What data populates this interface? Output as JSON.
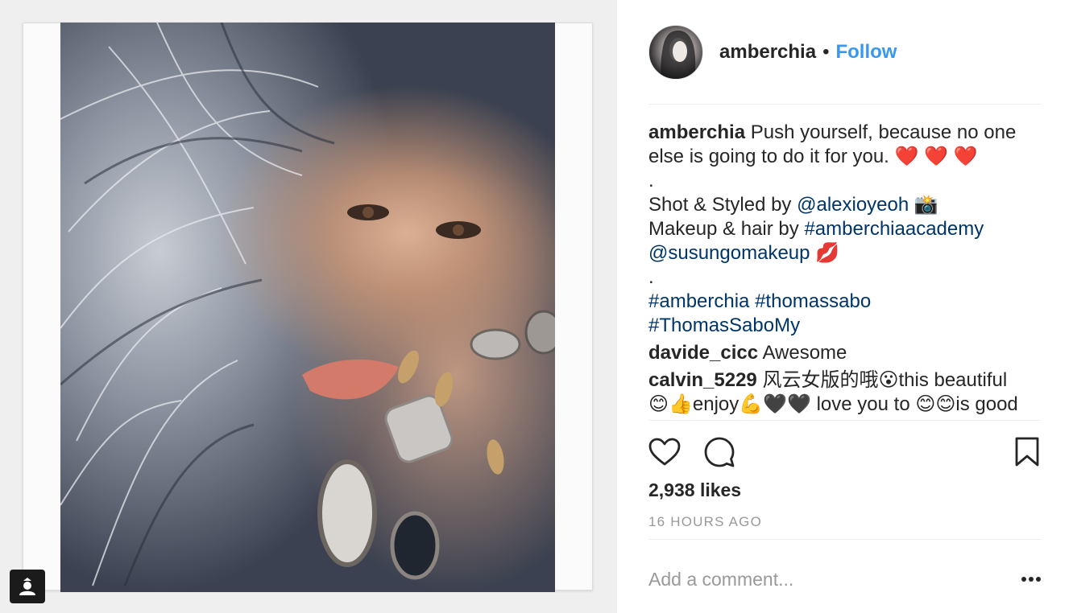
{
  "post": {
    "author": "amberchia",
    "separator": "•",
    "follow_label": "Follow",
    "photo_alt": "portrait",
    "likes": "2,938 likes",
    "timestamp": "16 HOURS AGO",
    "comment_placeholder": "Add a comment...",
    "more_label": "•••"
  },
  "caption": {
    "username": "amberchia",
    "line1": "Push yourself, because no one",
    "line2": "else is going to do it for you.",
    "hearts": "❤️ ❤️ ❤️",
    "dot1": ".",
    "shot_prefix": "Shot & Styled by",
    "shot_mention": "@alexioyeoh",
    "shot_emoji": "📸",
    "makeup_prefix": "Makeup & hair by",
    "makeup_tag": "#amberchiaacademy",
    "makeup_mention": "@susungomakeup",
    "makeup_emoji": "💋",
    "dot2": ".",
    "tag1": "#amberchia",
    "tag2": "#thomassabo",
    "tag3": "#ThomasSaboMy"
  },
  "comments": [
    {
      "user": "davide_cicc",
      "text": "Awesome"
    },
    {
      "user": "calvin_5229",
      "text": "风云女版的哦😮this beautiful",
      "text2": "😊👍enjoy💪🖤🖤 love you to 😊😊is good"
    }
  ],
  "icons": {
    "like": "heart-icon",
    "comment": "comment-icon",
    "save": "bookmark-icon",
    "user_tag": "user-tag-icon",
    "more": "more-icon"
  },
  "colors": {
    "link": "#003569",
    "follow": "#3897f0",
    "muted": "#999999",
    "text": "#262626"
  }
}
